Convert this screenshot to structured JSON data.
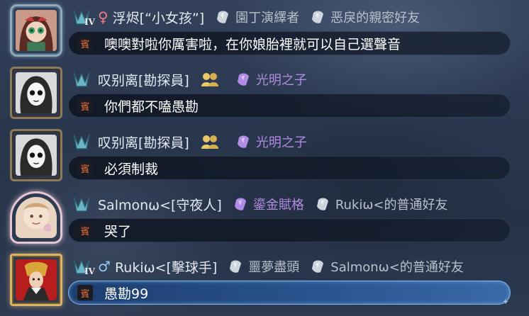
{
  "channel_tag": "賓",
  "colors": {
    "female": "#f07a8a",
    "male": "#8fc8f0",
    "grey_badge": "#b9c0cb",
    "purple_badge": "#b38be0",
    "tag_text": "#e06b3c",
    "highlight_border": "#7fb6ee"
  },
  "messages": [
    {
      "rank_icon": "rank-emblem-icon",
      "rank_level": "IV",
      "gender_symbol": "♀",
      "player_name": "浮烬[“小女孩”]",
      "badges": [
        {
          "icon": "gem-icon",
          "text": "園丁演繹者",
          "color": "grey"
        },
        {
          "icon": "gem-icon",
          "text": "恶戾的親密好友",
          "color": "grey"
        }
      ],
      "text": "噢噢對啦你厲害啦，在你娘胎裡就可以自己選聲音"
    },
    {
      "rank_icon": "rank-emblem-icon",
      "rank_level": "",
      "gender_symbol": "",
      "player_name": "叹别离[勘探員]",
      "badges": [
        {
          "icon": "group-icon",
          "text": "",
          "color": "gold"
        },
        {
          "icon": "gem-icon",
          "text": "光明之子",
          "color": "purple"
        }
      ],
      "text": "你們都不嗑愚勘"
    },
    {
      "rank_icon": "rank-emblem-icon",
      "rank_level": "",
      "gender_symbol": "",
      "player_name": "叹别离[勘探員]",
      "badges": [
        {
          "icon": "group-icon",
          "text": "",
          "color": "gold"
        },
        {
          "icon": "gem-icon",
          "text": "光明之子",
          "color": "purple"
        }
      ],
      "text": "必須制裁"
    },
    {
      "rank_icon": "rank-emblem-icon",
      "rank_level": "",
      "gender_symbol": "",
      "player_name": "Salmonω<[守夜人]",
      "badges": [
        {
          "icon": "gem-icon",
          "text": "鎏金賦格",
          "color": "purple"
        },
        {
          "icon": "gem-icon",
          "text": "Rukiω<的普通好友",
          "color": "grey"
        }
      ],
      "text": "哭了"
    },
    {
      "rank_icon": "rank-emblem-icon",
      "rank_level": "IV",
      "gender_symbol": "♂",
      "player_name": "Rukiω<[擊球手]",
      "badges": [
        {
          "icon": "gem-icon",
          "text": "噩夢盡頭",
          "color": "grey"
        },
        {
          "icon": "gem-icon",
          "text": "Salmonω<的普通好友",
          "color": "grey"
        }
      ],
      "text": "愚勘99"
    }
  ]
}
